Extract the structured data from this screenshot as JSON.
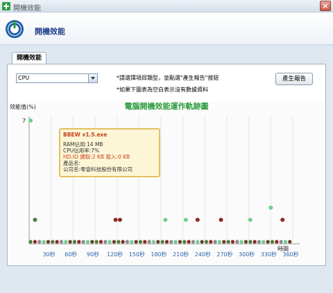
{
  "window": {
    "title": "開機效能"
  },
  "header": {
    "title": "開機效能"
  },
  "tabs": [
    {
      "label": "開機效能"
    }
  ],
  "controls": {
    "select_value": "CPU",
    "hint_line1": "*請選擇項目類型，並點選\"產生報告\"按鈕",
    "hint_line2": "*如果下圖表為空白表示沒有數據資料",
    "report_button": "產生報告"
  },
  "tooltip": {
    "title": "BBEW v1.5.exe",
    "ram": "RAM佔用:14 MB",
    "cpu": "CPU佔用率:7%",
    "hdio": "HD.IO  讀取:2 KB   寫入:0 KB",
    "product": "產品名:",
    "company": "公司名:零壹科技股份有限公司"
  },
  "chart_data": {
    "type": "scatter",
    "title": "電腦開機效能運作軌跡圖",
    "ylabel": "效能值(%)",
    "xlabel": "時間",
    "y_tick_top": "7",
    "x_ticks": [
      "30秒",
      "60秒",
      "90秒",
      "120秒",
      "150秒",
      "180秒",
      "210秒",
      "240秒",
      "270秒",
      "300秒",
      "330秒",
      "360秒"
    ],
    "xlim": [
      0,
      360
    ],
    "ylim": [
      0,
      7
    ],
    "colors": {
      "green": "#6fcf8f",
      "darkred": "#8a2a22",
      "darkgreen": "#4a7d3a",
      "gray": "#8a8a8a"
    },
    "points": [
      {
        "x": 2,
        "y": 7,
        "c": "green"
      },
      {
        "x": 8,
        "y": 1.3,
        "c": "darkgreen"
      },
      {
        "x": 118,
        "y": 1.3,
        "c": "darkred"
      },
      {
        "x": 124,
        "y": 1.3,
        "c": "darkred"
      },
      {
        "x": 186,
        "y": 1.3,
        "c": "green"
      },
      {
        "x": 214,
        "y": 1.3,
        "c": "green"
      },
      {
        "x": 230,
        "y": 1.3,
        "c": "darkred"
      },
      {
        "x": 262,
        "y": 1.3,
        "c": "darkred"
      },
      {
        "x": 302,
        "y": 1.3,
        "c": "green"
      },
      {
        "x": 330,
        "y": 2.0,
        "c": "green"
      },
      {
        "x": 346,
        "y": 1.3,
        "c": "darkred"
      }
    ],
    "baseline_spacing": 6
  }
}
